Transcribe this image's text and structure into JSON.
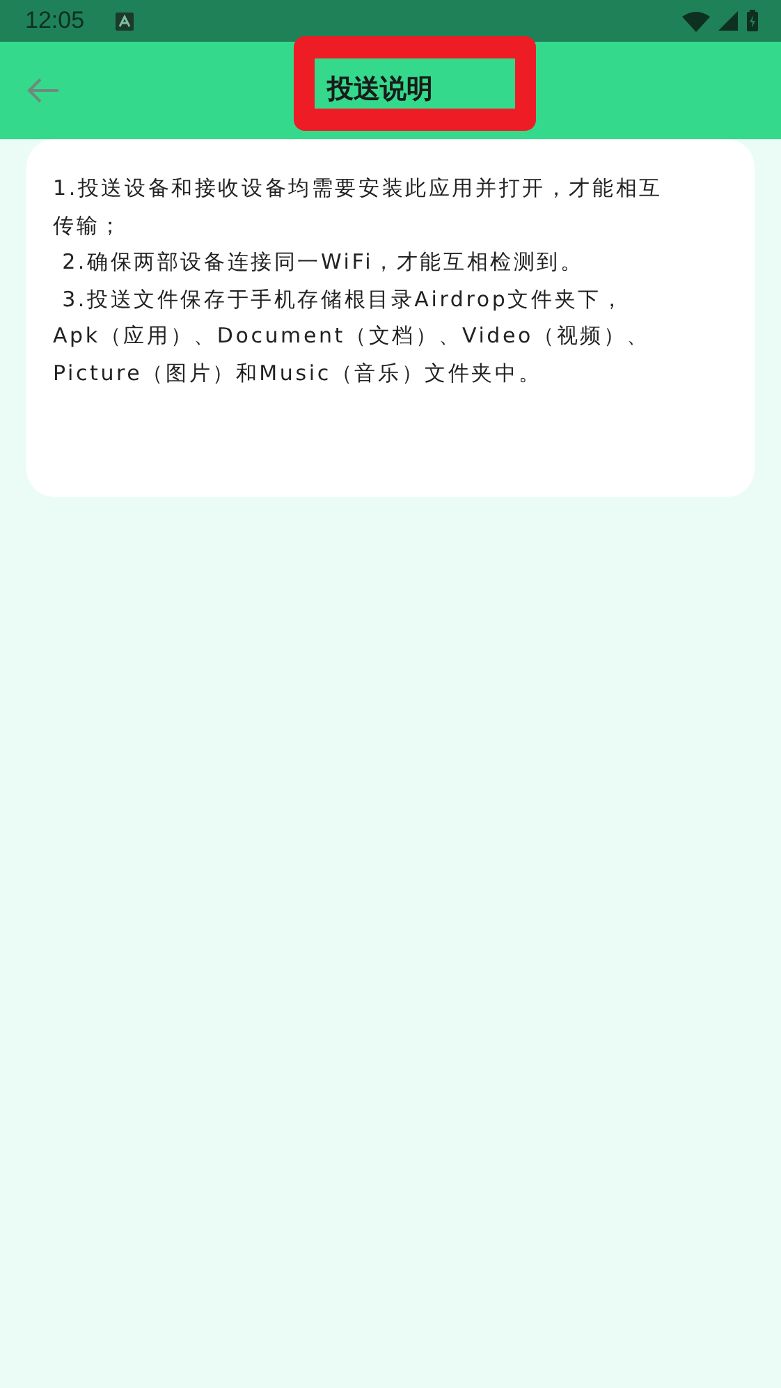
{
  "status_bar": {
    "time": "12:05"
  },
  "app_bar": {
    "title": "投送说明",
    "title_highlighted": true
  },
  "notes": {
    "lines": [
      "1.投送设备和接收设备均需要安装此应用并打开，才能相互",
      "传输；",
      " 2.确保两部设备连接同一WiFi，才能互相检测到。",
      " 3.投送文件保存于手机存储根目录Airdrop文件夹下，",
      "Apk（应用）、Document（文档）、Video（视频）、",
      "Picture（图片）和Music（音乐）文件夹中。"
    ]
  }
}
